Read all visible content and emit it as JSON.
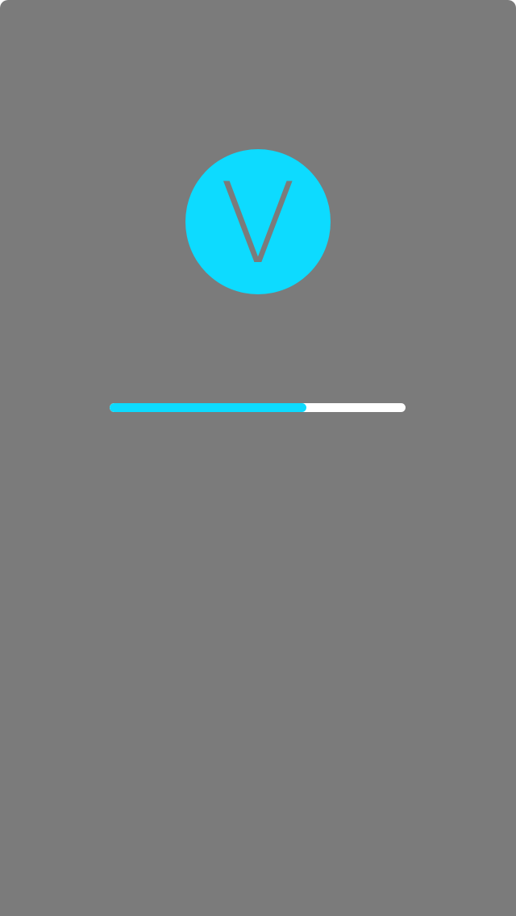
{
  "splash": {
    "logo_letter": "V",
    "accent_color": "#0ddbff",
    "background_color": "#7b7b7b",
    "progress_track_color": "#ffffff",
    "progress_fraction": 0.665
  }
}
